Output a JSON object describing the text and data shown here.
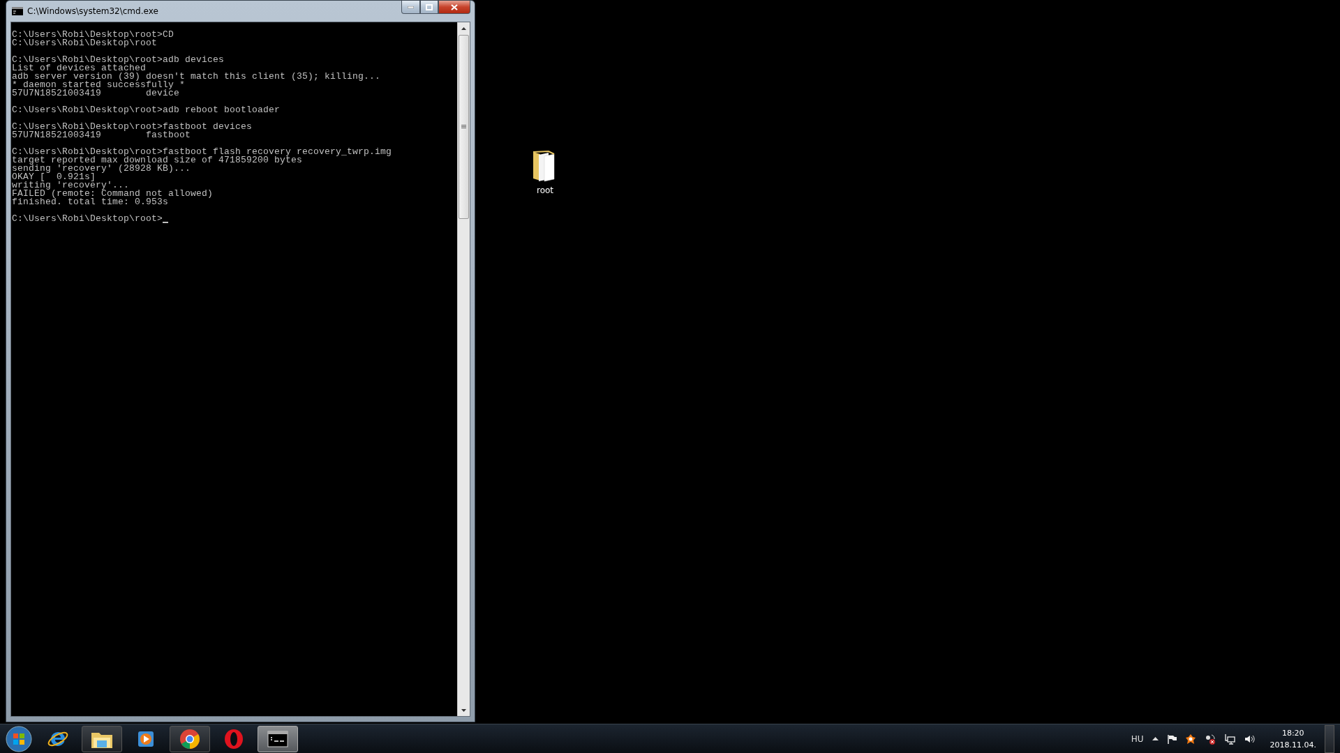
{
  "window": {
    "title": "C:\\Windows\\system32\\cmd.exe"
  },
  "console": {
    "blocks": [
      {
        "lines": [
          "C:\\Users\\Robi\\Desktop\\root>CD",
          "C:\\Users\\Robi\\Desktop\\root"
        ]
      },
      {
        "lines": [
          "C:\\Users\\Robi\\Desktop\\root>adb devices",
          "List of devices attached",
          "adb server version (39) doesn't match this client (35); killing...",
          "* daemon started successfully *",
          "57U7N18521003419        device"
        ]
      },
      {
        "lines": [
          "C:\\Users\\Robi\\Desktop\\root>adb reboot bootloader"
        ]
      },
      {
        "lines": [
          "C:\\Users\\Robi\\Desktop\\root>fastboot devices",
          "57U7N18521003419        fastboot"
        ]
      },
      {
        "lines": [
          "C:\\Users\\Robi\\Desktop\\root>fastboot flash recovery recovery_twrp.img",
          "target reported max download size of 471859200 bytes",
          "sending 'recovery' (28928 KB)...",
          "OKAY [  0.921s]",
          "writing 'recovery'...",
          "FAILED (remote: Command not allowed)",
          "finished. total time: 0.953s"
        ]
      }
    ],
    "prompt": "C:\\Users\\Robi\\Desktop\\root>"
  },
  "desktop_icons": [
    {
      "label": "root"
    }
  ],
  "taskbar": {
    "items": [
      {
        "kind": "ie",
        "running": false,
        "active": false
      },
      {
        "kind": "explorer",
        "running": true,
        "active": false
      },
      {
        "kind": "media",
        "running": false,
        "active": false
      },
      {
        "kind": "chrome",
        "running": true,
        "active": false
      },
      {
        "kind": "opera",
        "running": false,
        "active": false
      },
      {
        "kind": "cmd",
        "running": true,
        "active": true
      }
    ]
  },
  "tray": {
    "language": "HU",
    "time": "18:20",
    "date": "2018.11.04."
  }
}
